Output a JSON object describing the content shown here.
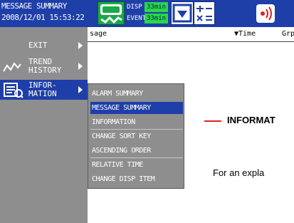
{
  "header": {
    "title": "MESSAGE SUMMARY",
    "datetime": "2008/12/01 15:53:22",
    "disp_label": "DISP",
    "disp_value": "33min",
    "event_label": "EVENT",
    "event_value": "33min",
    "icons": [
      "display-trend-icon",
      "sort-order-icon",
      "calculator-icon",
      "alarm-speaker-icon"
    ]
  },
  "sidebar": {
    "items": [
      {
        "label": "EXIT"
      },
      {
        "label_line1": "TREND",
        "label_line2": "HISTORY"
      },
      {
        "label_line1": "INFOR-",
        "label_line2": "MATION"
      }
    ]
  },
  "columns": {
    "message": "sage",
    "time": "▼Time",
    "group": "Grp"
  },
  "submenu": {
    "items": [
      "ALARM SUMMARY",
      "MESSAGE SUMMARY",
      "INFORMATION",
      "CHANGE SORT KEY",
      "ASCENDING ORDER",
      "RELATIVE TIME",
      "CHANGE DISP ITEM"
    ],
    "selected_index": 1
  },
  "callout": {
    "label": "INFORMAT",
    "explanation": "For an expla"
  },
  "colors": {
    "header_bg": "#1e3fa8",
    "menu_bg": "#8e8e8e",
    "selected_bg": "#1e3fa8",
    "callout_line": "#e02020",
    "mode_value_bg": "#2bd64a"
  }
}
